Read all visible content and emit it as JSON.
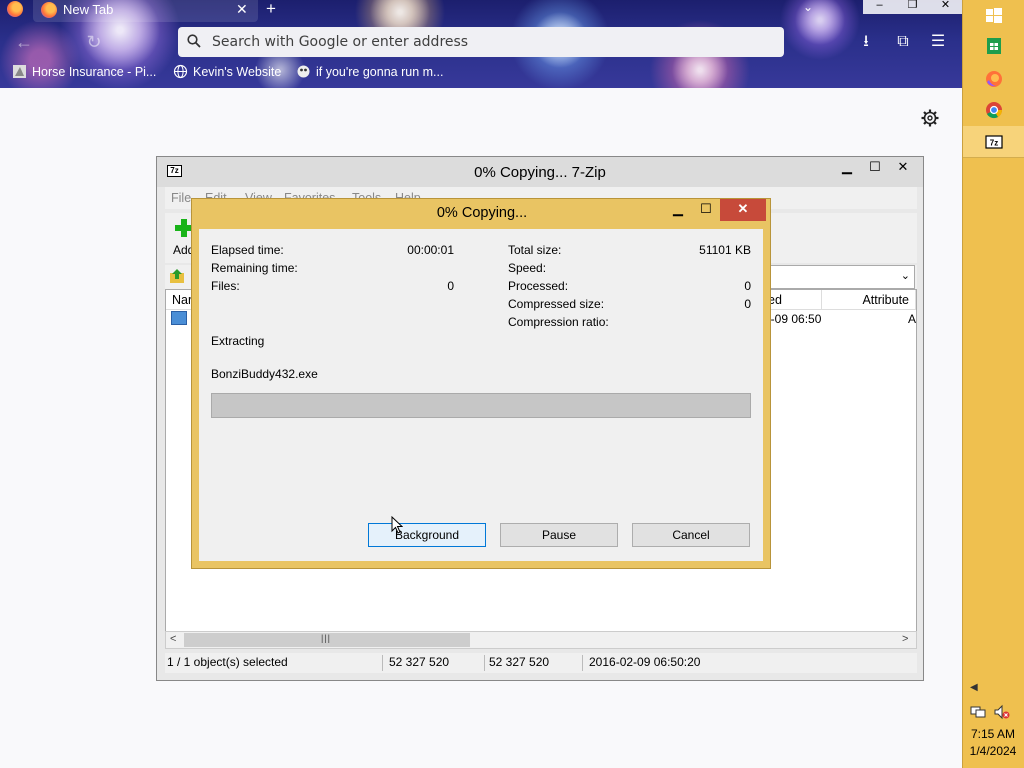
{
  "browser": {
    "tab_title": "New Tab",
    "url_placeholder": "Search with Google or enter address",
    "bookmarks": [
      {
        "label": "Horse Insurance - Pi..."
      },
      {
        "label": "Kevin's Website"
      },
      {
        "label": "if you're gonna run m..."
      }
    ]
  },
  "zip": {
    "title": "0% Copying... 7-Zip",
    "menu": [
      "File",
      "Edit",
      "View",
      "Favorites",
      "Tools",
      "Help"
    ],
    "toolbar": {
      "add_label": "Add"
    },
    "columns": {
      "name": "Nar",
      "modified": "ed",
      "attributes": "Attribute"
    },
    "file_row": {
      "name_fragment": "B",
      "modified": "2-09 06:50",
      "attr": "A"
    },
    "status": {
      "selected": "1 / 1 object(s) selected",
      "size": "52 327 520",
      "packed": "52 327 520",
      "modified": "2016-02-09 06:50:20"
    }
  },
  "dialog": {
    "title": "0% Copying...",
    "labels": {
      "elapsed": "Elapsed time:",
      "remaining": "Remaining time:",
      "files": "Files:",
      "total_size": "Total size:",
      "speed": "Speed:",
      "processed": "Processed:",
      "compressed_size": "Compressed size:",
      "compression_ratio": "Compression ratio:"
    },
    "values": {
      "elapsed": "00:00:01",
      "remaining": "",
      "files": "0",
      "total_size": "51101 KB",
      "speed": "",
      "processed": "0",
      "compressed_size": "0",
      "compression_ratio": ""
    },
    "operation": "Extracting",
    "current_file": "BonziBuddy432.exe",
    "progress_percent": 0,
    "buttons": {
      "background": "Background",
      "pause": "Pause",
      "cancel": "Cancel"
    }
  },
  "taskbar": {
    "items": [
      "start-icon",
      "sheets-icon",
      "firefox-icon",
      "chrome-icon",
      "7zip-icon"
    ],
    "clock_time": "7:15 AM",
    "clock_date": "1/4/2024"
  },
  "colors": {
    "dialog_frame": "#e9c463",
    "taskbar": "#efc04f",
    "close_red": "#c74a3a"
  }
}
